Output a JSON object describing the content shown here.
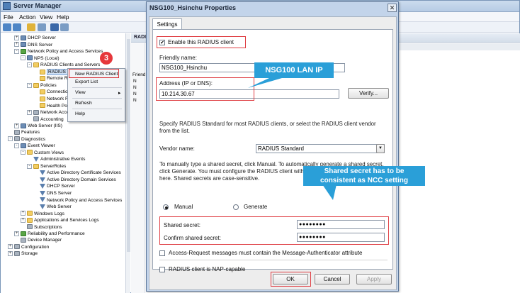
{
  "server_manager": {
    "title": "Server Manager",
    "menu": [
      "File",
      "Action",
      "View",
      "Help"
    ],
    "tree": [
      {
        "label": "DHCP Server",
        "indent": 0,
        "exp": "+",
        "icon": "server"
      },
      {
        "label": "DNS Server",
        "indent": 0,
        "exp": "+",
        "icon": "server"
      },
      {
        "label": "Network Policy and Access Services",
        "indent": 0,
        "exp": "-",
        "icon": "green"
      },
      {
        "label": "NPS (Local)",
        "indent": 1,
        "exp": "-",
        "icon": "server"
      },
      {
        "label": "RADIUS Clients and Servers",
        "indent": 2,
        "exp": "-",
        "icon": "folder"
      },
      {
        "label": "RADIUS C",
        "indent": 3,
        "exp": "",
        "icon": "folder",
        "selected": true
      },
      {
        "label": "Remote R",
        "indent": 3,
        "exp": "",
        "icon": "folder"
      },
      {
        "label": "Policies",
        "indent": 2,
        "exp": "-",
        "icon": "folder"
      },
      {
        "label": "Connectio",
        "indent": 3,
        "exp": "",
        "icon": "folder"
      },
      {
        "label": "Network F",
        "indent": 3,
        "exp": "",
        "icon": "folder"
      },
      {
        "label": "Health Po",
        "indent": 3,
        "exp": "",
        "icon": "folder"
      },
      {
        "label": "Network Acce",
        "indent": 2,
        "exp": "+",
        "icon": "gray"
      },
      {
        "label": "Accounting",
        "indent": 2,
        "exp": "",
        "icon": "gray"
      },
      {
        "label": "Web Server (IIS)",
        "indent": 0,
        "exp": "+",
        "icon": "server"
      },
      {
        "label": "Features",
        "indent": -1,
        "exp": "",
        "icon": "gray"
      },
      {
        "label": "Diagnostics",
        "indent": -1,
        "exp": "-",
        "icon": "gray"
      },
      {
        "label": "Event Viewer",
        "indent": 0,
        "exp": "-",
        "icon": "server"
      },
      {
        "label": "Custom Views",
        "indent": 1,
        "exp": "-",
        "icon": "folder"
      },
      {
        "label": "Administrative Events",
        "indent": 2,
        "exp": "",
        "icon": "filter"
      },
      {
        "label": "ServerRoles",
        "indent": 2,
        "exp": "-",
        "icon": "folder"
      },
      {
        "label": "Active Directory Certificate Services",
        "indent": 3,
        "exp": "",
        "icon": "filter"
      },
      {
        "label": "Active Directory Domain Services",
        "indent": 3,
        "exp": "",
        "icon": "filter"
      },
      {
        "label": "DHCP Server",
        "indent": 3,
        "exp": "",
        "icon": "filter"
      },
      {
        "label": "DNS Server",
        "indent": 3,
        "exp": "",
        "icon": "filter"
      },
      {
        "label": "Network Policy and Access Services",
        "indent": 3,
        "exp": "",
        "icon": "filter"
      },
      {
        "label": "Web Server",
        "indent": 3,
        "exp": "",
        "icon": "filter"
      },
      {
        "label": "Windows Logs",
        "indent": 1,
        "exp": "+",
        "icon": "folder"
      },
      {
        "label": "Applications and Services Logs",
        "indent": 1,
        "exp": "+",
        "icon": "folder"
      },
      {
        "label": "Subscriptions",
        "indent": 1,
        "exp": "",
        "icon": "gray"
      },
      {
        "label": "Reliability and Performance",
        "indent": 0,
        "exp": "+",
        "icon": "green"
      },
      {
        "label": "Device Manager",
        "indent": 0,
        "exp": "",
        "icon": "gray"
      },
      {
        "label": "Configuration",
        "indent": -1,
        "exp": "+",
        "icon": "gray"
      },
      {
        "label": "Storage",
        "indent": -1,
        "exp": "+",
        "icon": "gray"
      }
    ],
    "right_header": "RADIU",
    "right_list_header": "Friend",
    "right_list_rows": [
      "N",
      "N",
      "N",
      "N"
    ]
  },
  "context_menu": {
    "items": [
      "New RADIUS Client",
      "Export List",
      "View",
      "Refresh",
      "Help"
    ],
    "view_arrow": "▸",
    "step_number": "3"
  },
  "dialog": {
    "title": "NSG100_Hsinchu Properties",
    "close_glyph": "✕",
    "tab": "Settings",
    "enable_label": "Enable this RADIUS client",
    "enable_checked": "✔",
    "friendly_name_label": "Friendly name:",
    "friendly_name_value": "NSG100_Hsinchu",
    "address_label": "Address (IP or DNS):",
    "address_value": "10.214.30.67",
    "verify_button": "Verify...",
    "vendor_help": "Specify RADIUS Standard for most RADIUS clients, or select the RADIUS client vendor from the list.",
    "vendor_label": "Vendor name:",
    "vendor_value": "RADIUS Standard",
    "vendor_arrow": "▼",
    "secret_help": "To manually type a shared secret, click Manual. To automatically generate a shared secret, click Generate. You must configure the RADIUS client with the same shared secret entered here. Shared secrets are case-sensitive.",
    "manual_label": "Manual",
    "generate_label": "Generate",
    "shared_secret_label": "Shared secret:",
    "shared_secret_value": "●●●●●●●●",
    "confirm_secret_label": "Confirm shared secret:",
    "confirm_secret_value": "●●●●●●●●",
    "access_request_label": "Access-Request messages must contain the Message-Authenticator attribute",
    "nap_label": "RADIUS client is NAP-capable",
    "ok_button": "OK",
    "cancel_button": "Cancel",
    "apply_button": "Apply"
  },
  "annotations": {
    "lan_ip_callout": "NSG100 LAN IP",
    "secret_callout_line1": "Shared secret has to be",
    "secret_callout_line2": "consistent as NCC setting",
    "callout_color": "#2a9fd8",
    "highlight_color": "#df3d42"
  }
}
